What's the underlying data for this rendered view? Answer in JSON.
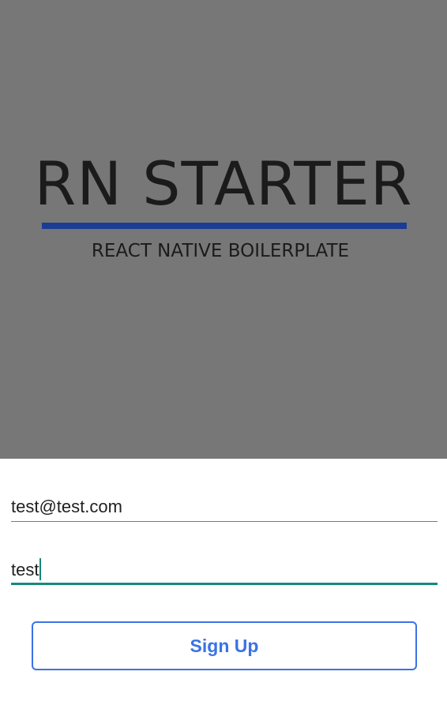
{
  "hero": {
    "title": "RN STARTER",
    "subtitle": "REACT NATIVE BOILERPLATE",
    "background_color": "#777777",
    "accent_color": "#1c3c94"
  },
  "form": {
    "email_value": "test@test.com",
    "password_value": "test",
    "focus_color": "#16897a",
    "signup_label": "Sign Up",
    "button_color": "#3a73e4"
  }
}
